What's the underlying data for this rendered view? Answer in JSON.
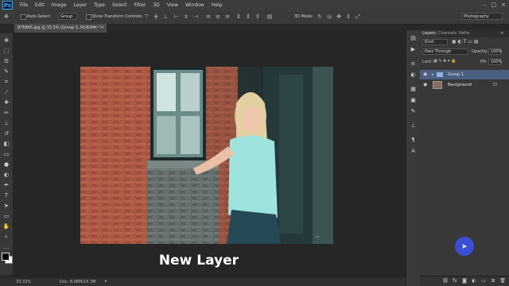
{
  "menu": {
    "logo": "Ps",
    "items": [
      "File",
      "Edit",
      "Image",
      "Layer",
      "Type",
      "Select",
      "Filter",
      "3D",
      "View",
      "Window",
      "Help"
    ],
    "window_controls": [
      "–",
      "□",
      "×"
    ]
  },
  "options": {
    "auto_select_label": "Auto-Select:",
    "auto_select_value": "Group",
    "transform_label": "Show Transform Controls",
    "mode_label": "3D Mode:",
    "workspace": "Photography"
  },
  "document": {
    "tab_title": "87688S.jpg @ 33.3% (Group 1, RGB/8#) *",
    "close": "×"
  },
  "caption": "New Layer",
  "status": {
    "zoom": "33.33%",
    "doc_info": "Doc: 8.08M/16.3M"
  },
  "layers_panel": {
    "tabs": [
      "Layers",
      "Channels",
      "Paths"
    ],
    "kind": "Kind",
    "blend_mode": "Pass Through",
    "opacity_label": "Opacity:",
    "opacity_value": "100%",
    "lock_label": "Lock:",
    "fill_label": "Fill:",
    "fill_value": "100%",
    "layers": [
      {
        "name": "Group 1",
        "type": "group",
        "selected": true
      },
      {
        "name": "Background",
        "type": "image",
        "selected": false
      }
    ]
  },
  "icons": {
    "eye": "eye-icon",
    "folder": "folder-icon",
    "lock": "lock-icon"
  },
  "colors": {
    "accent": "#31a8ff",
    "selected_layer": "#4b5f80",
    "cursor_highlight": "#3a4fd6"
  }
}
